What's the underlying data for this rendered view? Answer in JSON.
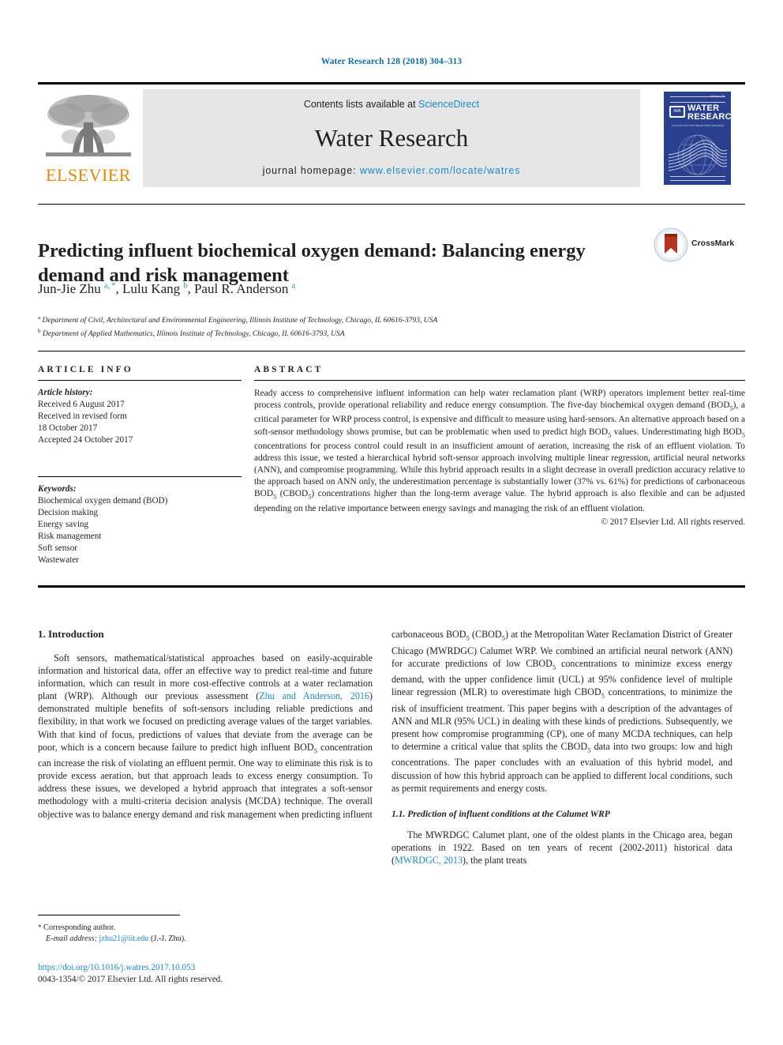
{
  "running_head": "Water Research 128 (2018) 304–313",
  "masthead": {
    "contents_prefix": "Contents lists available at ",
    "sciencedirect": "ScienceDirect",
    "journal_title": "Water Research",
    "homepage_label": "journal homepage:",
    "homepage_url": "www.elsevier.com/locate/watres",
    "publisher_logo_text": "ELSEVIER",
    "cover": {
      "journal_name_line1": "WATER",
      "journal_name_line2": "RESEARCH",
      "society_badge": "IWA",
      "volume_note": "Volume 128",
      "tagline": "A Journal of the International Water Association"
    }
  },
  "article": {
    "title": "Predicting influent biochemical oxygen demand: Balancing energy demand and risk management",
    "crossmark_label": "CrossMark",
    "authors_html": "Jun-Jie Zhu <sup>a, *</sup>, Lulu Kang <sup>b</sup>, Paul R. Anderson <sup>a</sup>",
    "affiliations": [
      {
        "marker": "a",
        "text": "Department of Civil, Architectural and Environmental Engineering, Illinois Institute of Technology, Chicago, IL 60616-3793, USA"
      },
      {
        "marker": "b",
        "text": "Department of Applied Mathematics, Illinois Institute of Technology, Chicago, IL 60616-3793, USA"
      }
    ]
  },
  "info": {
    "heading": "ARTICLE INFO",
    "history_label": "Article history:",
    "history_lines": [
      "Received 6 August 2017",
      "Received in revised form",
      "18 October 2017",
      "Accepted 24 October 2017"
    ],
    "keywords_label": "Keywords:",
    "keywords": [
      "Biochemical oxygen demand (BOD)",
      "Decision making",
      "Energy saving",
      "Risk management",
      "Soft sensor",
      "Wastewater"
    ]
  },
  "abstract": {
    "heading": "ABSTRACT",
    "body_html": "Ready access to comprehensive influent information can help water reclamation plant (WRP) operators implement better real-time process controls, provide operational reliability and reduce energy consumption. The five-day biochemical oxygen demand (BOD<sub>5</sub>), a critical parameter for WRP process control, is expensive and difficult to measure using hard-sensors. An alternative approach based on a soft-sensor methodology shows promise, but can be problematic when used to predict high BOD<sub>5</sub> values. Underestimating high BOD<sub>5</sub> concentrations for process control could result in an insufficient amount of aeration, increasing the risk of an effluent violation. To address this issue, we tested a hierarchical hybrid soft-sensor approach involving multiple linear regression, artificial neural networks (ANN), and compromise programming. While this hybrid approach results in a slight decrease in overall prediction accuracy relative to the approach based on ANN only, the underestimation percentage is substantially lower (37% vs. 61%) for predictions of carbonaceous BOD<sub>5</sub> (CBOD<sub>5</sub>) concentrations higher than the long-term average value. The hybrid approach is also flexible and can be adjusted depending on the relative importance between energy savings and managing the risk of an effluent violation.",
    "copyright": "© 2017 Elsevier Ltd. All rights reserved."
  },
  "body": {
    "section_heading": "1. Introduction",
    "left_paragraph_html": "Soft sensors, mathematical/statistical approaches based on easily-acquirable information and historical data, offer an effective way to predict real-time and future information, which can result in more cost-effective controls at a water reclamation plant (WRP). Although our previous assessment (<span class=\"cite\">Zhu and Anderson, 2016</span>) demonstrated multiple benefits of soft-sensors including reliable predictions and flexibility, in that work we focused on predicting average values of the target variables. With that kind of focus, predictions of values that deviate from the average can be poor, which is a concern because failure to predict high influent BOD<sub>5</sub> concentration can increase the risk of violating an effluent permit. One way to eliminate this risk is to provide excess aeration, but that approach leads to excess energy consumption. To address these issues, we developed a hybrid approach that integrates a soft-sensor methodology with a multi-criteria decision analysis (MCDA) technique. The overall objective was to balance energy demand and risk management when predicting influent",
    "right_paragraph_html": "carbonaceous BOD<sub>5</sub> (CBOD<sub>5</sub>) at the Metropolitan Water Reclamation District of Greater Chicago (MWRDGC) Calumet WRP. We combined an artificial neural network (ANN) for accurate predictions of low CBOD<sub>5</sub> concentrations to minimize excess energy demand, with the upper confidence limit (UCL) at 95% confidence level of multiple linear regression (MLR) to overestimate high CBOD<sub>5</sub> concentrations, to minimize the risk of insufficient treatment. This paper begins with a description of the advantages of ANN and MLR (95% UCL) in dealing with these kinds of predictions. Subsequently, we present how compromise programming (CP), one of many MCDA techniques, can help to determine a critical value that splits the CBOD<sub>5</sub> data into two groups: low and high concentrations. The paper concludes with an evaluation of this hybrid model, and discussion of how this hybrid approach can be applied to different local conditions, such as permit requirements and energy costs.",
    "subsection_heading": "1.1. Prediction of influent conditions at the Calumet WRP",
    "subsection_paragraph_html": "The MWRDGC Calumet plant, one of the oldest plants in the Chicago area, began operations in 1922. Based on ten years of recent (2002-2011) historical data (<span class=\"cite\">MWRDGC, 2013</span>), the plant treats"
  },
  "footer": {
    "corresponding_marker": "*",
    "corresponding_label": "Corresponding author.",
    "email_label": "E-mail address:",
    "email": "jzhu21@iit.edu",
    "email_attrib": "(J.-J. Zhu).",
    "doi": "https://doi.org/10.1016/j.watres.2017.10.053",
    "issn_line": "0043-1354/© 2017 Elsevier Ltd. All rights reserved."
  },
  "colors": {
    "link_blue": "#1a8ac9",
    "runhead_blue": "#0b6ea8",
    "elsevier_orange": "#ef8200",
    "cover_blue": "#2b3f8f",
    "masthead_grey": "#e6e6e6"
  }
}
